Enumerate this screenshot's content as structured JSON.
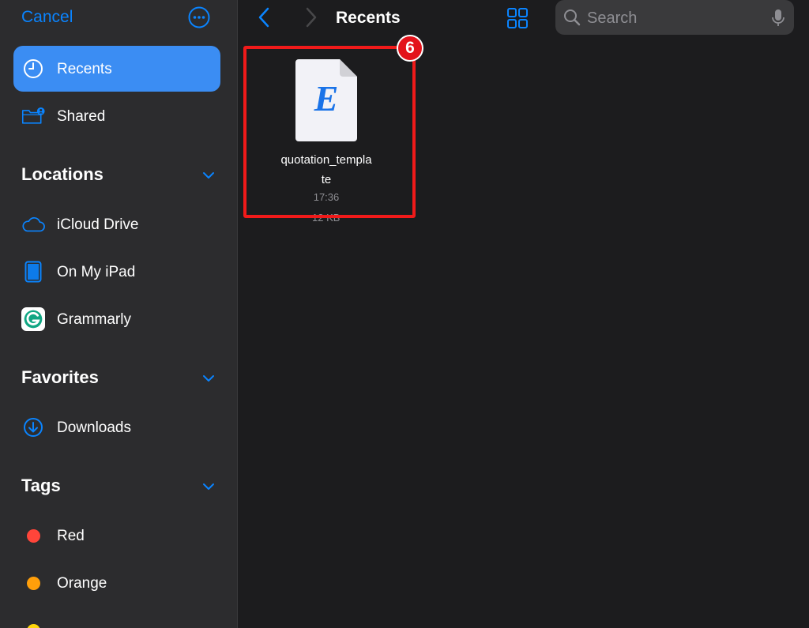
{
  "sidebar": {
    "cancel_label": "Cancel",
    "more_icon": "ellipsis-circle-icon",
    "recents_label": "Recents",
    "shared_label": "Shared",
    "locations": {
      "title": "Locations",
      "items": [
        "iCloud Drive",
        "On My iPad",
        "Grammarly"
      ]
    },
    "favorites": {
      "title": "Favorites",
      "items": [
        "Downloads"
      ]
    },
    "tags": {
      "title": "Tags",
      "items": [
        {
          "label": "Red",
          "color": "#ff453a"
        },
        {
          "label": "Orange",
          "color": "#ff9f0a"
        }
      ]
    },
    "accent_color": "#0a84ff",
    "selected_color": "#3b8df3"
  },
  "header": {
    "title": "Recents",
    "search_placeholder": "Search"
  },
  "files": [
    {
      "name_line1": "quotation_templa",
      "name_line2": "te",
      "time": "17:36",
      "size": "12 KB",
      "icon_letter": "E"
    }
  ],
  "annotation": {
    "badge": "6",
    "color": "#f01a1a"
  }
}
